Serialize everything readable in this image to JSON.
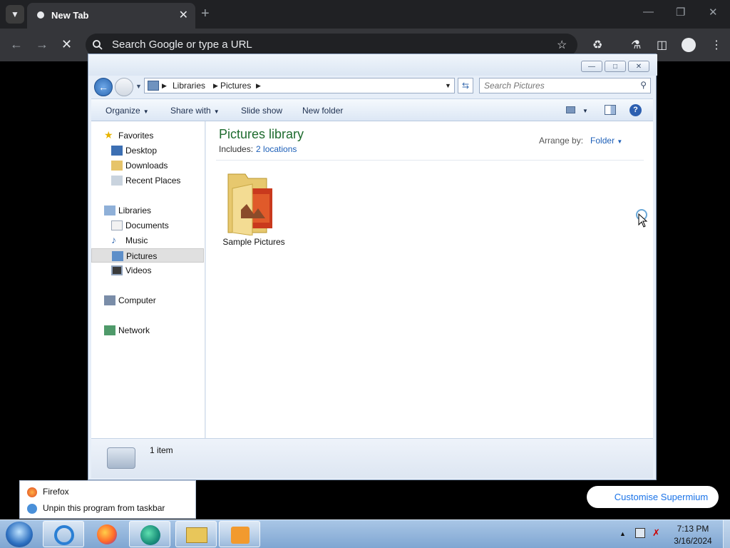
{
  "browser": {
    "tab_title": "New Tab",
    "omnibox_placeholder": "Search Google or type a URL",
    "customise_label": "Customise Supermium"
  },
  "explorer": {
    "breadcrumb": [
      "Libraries",
      "Pictures"
    ],
    "search_placeholder": "Search Pictures",
    "toolbar": {
      "organize": "Organize",
      "share_with": "Share with",
      "slide_show": "Slide show",
      "new_folder": "New folder"
    },
    "nav": {
      "favorites": "Favorites",
      "desktop": "Desktop",
      "downloads": "Downloads",
      "recent_places": "Recent Places",
      "libraries": "Libraries",
      "documents": "Documents",
      "music": "Music",
      "pictures": "Pictures",
      "videos": "Videos",
      "computer": "Computer",
      "network": "Network"
    },
    "content": {
      "title": "Pictures library",
      "includes_label": "Includes:",
      "includes_link": "2 locations",
      "arrange_label": "Arrange by:",
      "arrange_value": "Folder",
      "items": [
        {
          "label": "Sample Pictures"
        }
      ]
    },
    "details": {
      "count": "1 item"
    }
  },
  "jumplist": {
    "app_name": "Firefox",
    "unpin": "Unpin this program from taskbar"
  },
  "taskbar": {
    "time": "7:13 PM",
    "date": "3/16/2024",
    "apps": [
      "internet-explorer",
      "firefox",
      "edge",
      "file-explorer",
      "media-player"
    ]
  }
}
